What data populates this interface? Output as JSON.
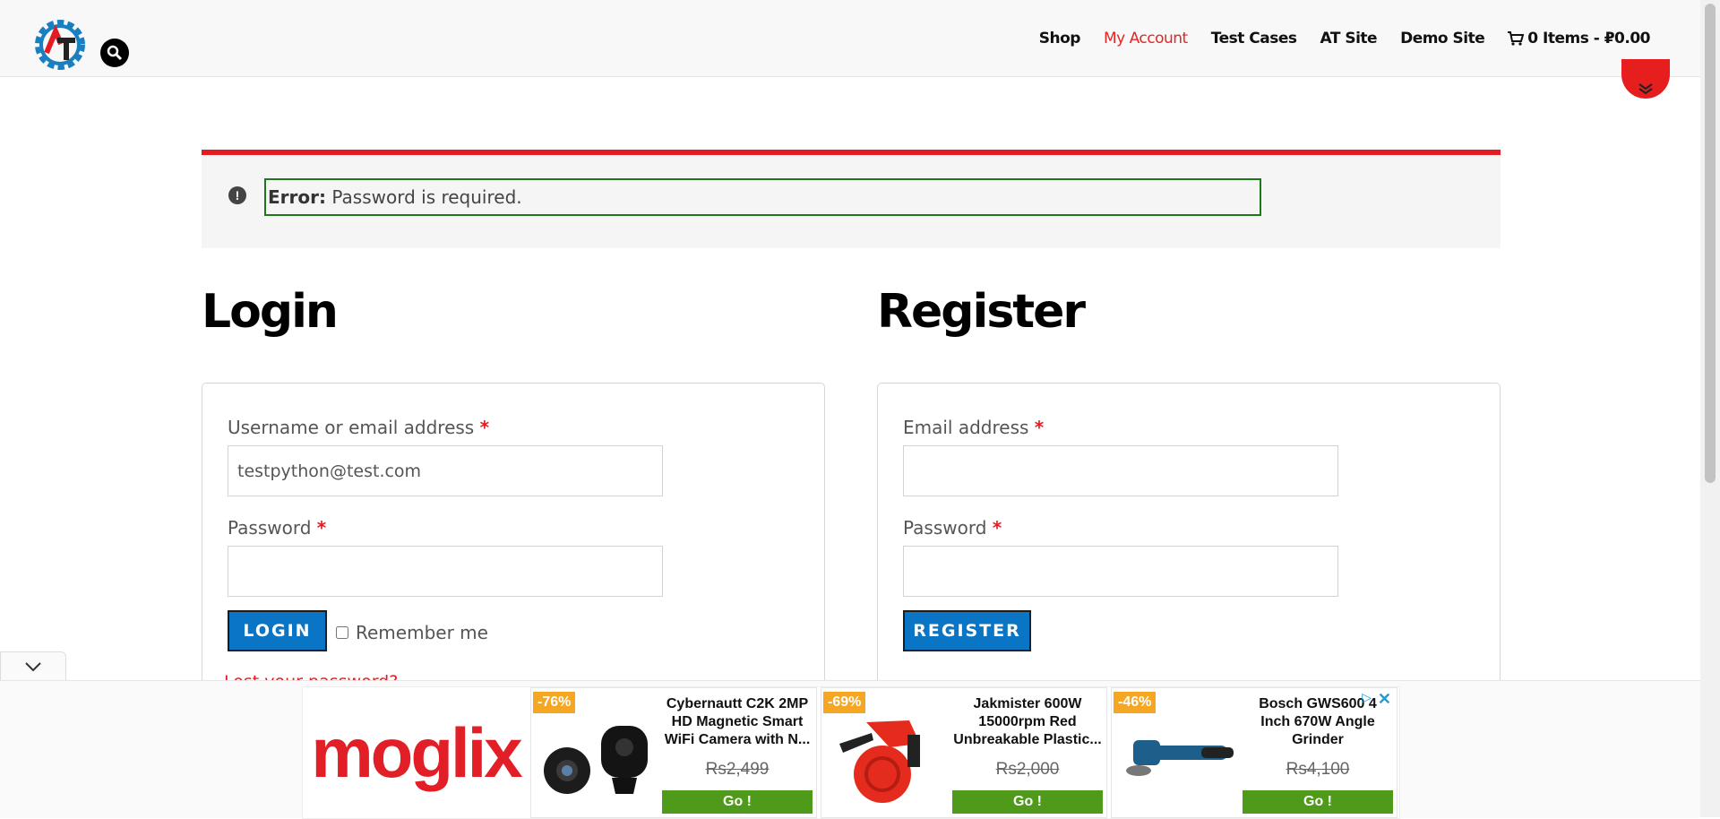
{
  "header": {
    "nav": [
      {
        "label": "Shop",
        "active": false
      },
      {
        "label": "My Account",
        "active": true
      },
      {
        "label": "Test Cases",
        "active": false
      },
      {
        "label": "AT Site",
        "active": false
      },
      {
        "label": "Demo Site",
        "active": false
      }
    ],
    "cart_label": "0 Items - ₽0.00",
    "logo_text": "AT"
  },
  "error": {
    "prefix": "Error:",
    "message": "Password is required."
  },
  "login": {
    "title": "Login",
    "username_label": "Username or email address",
    "username_value": "testpython@test.com",
    "password_label": "Password",
    "button": "LOGIN",
    "remember": "Remember me",
    "lost_password": "Lost your password?"
  },
  "register": {
    "title": "Register",
    "email_label": "Email address",
    "password_label": "Password",
    "button": "REGISTER"
  },
  "required_mark": "*",
  "ad": {
    "brand": "moglix",
    "products": [
      {
        "discount": "-76%",
        "title": "Cybernautt C2K 2MP HD Magnetic Smart WiFi Camera with N...",
        "price": "Rs2,499",
        "go": "Go !"
      },
      {
        "discount": "-69%",
        "title": "Jakmister 600W 15000rpm Red Unbreakable Plastic...",
        "price": "Rs2,000",
        "go": "Go !"
      },
      {
        "discount": "-46%",
        "title": "Bosch GWS600 4 Inch 670W Angle Grinder",
        "price": "Rs4,100",
        "go": "Go !"
      }
    ]
  },
  "colors": {
    "accent_red": "#e31c23",
    "button_blue": "#0a75c4",
    "error_border_green": "#1a7a1a",
    "go_green": "#4f9a1a"
  }
}
